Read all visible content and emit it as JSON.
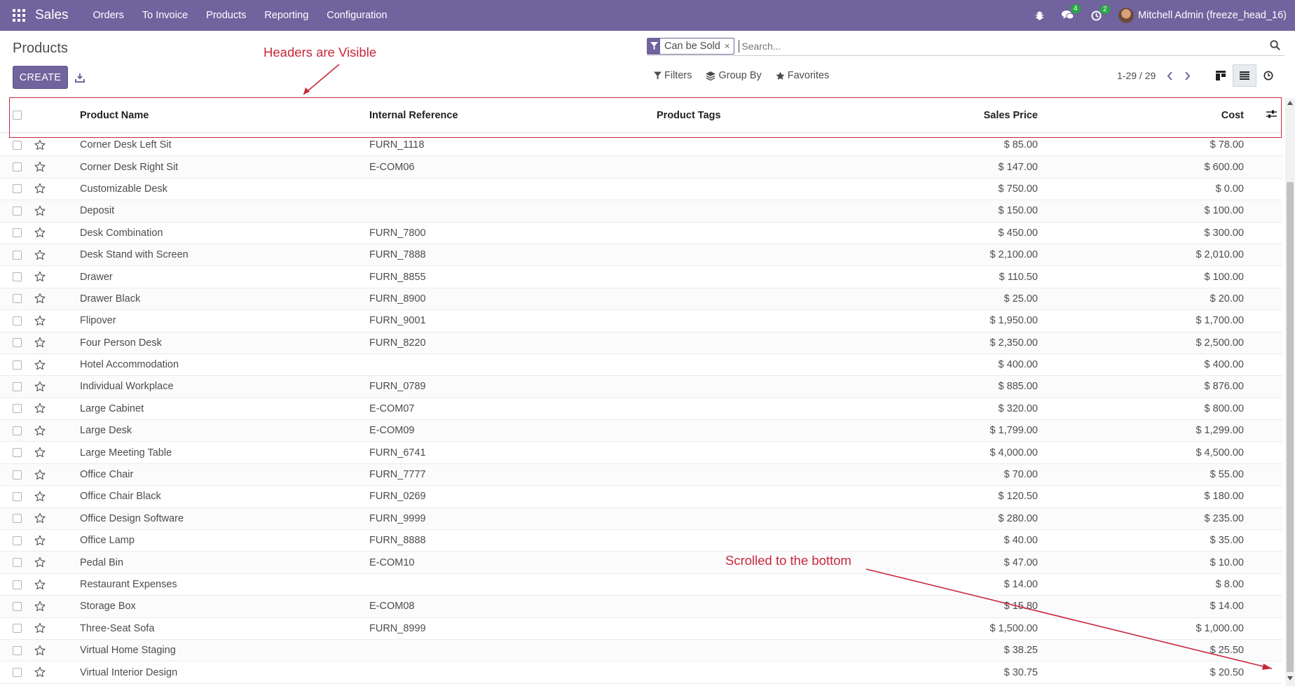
{
  "navbar": {
    "app_name": "Sales",
    "menu": [
      "Orders",
      "To Invoice",
      "Products",
      "Reporting",
      "Configuration"
    ],
    "messages_count": "4",
    "activities_count": "2",
    "user": "Mitchell Admin (freeze_head_16)"
  },
  "control_panel": {
    "title": "Products",
    "create_label": "CREATE",
    "facet": "Can be Sold",
    "facet_remove": "×",
    "search_placeholder": "Search...",
    "filters_label": "Filters",
    "groupby_label": "Group By",
    "favorites_label": "Favorites",
    "pager": "1-29 / 29"
  },
  "list": {
    "headers": {
      "name": "Product Name",
      "ref": "Internal Reference",
      "tags": "Product Tags",
      "price": "Sales Price",
      "cost": "Cost"
    },
    "rows": [
      {
        "name": "Corner Desk Left Sit",
        "ref": "FURN_1118",
        "tags": "",
        "price": "$ 85.00",
        "cost": "$ 78.00"
      },
      {
        "name": "Corner Desk Right Sit",
        "ref": "E-COM06",
        "tags": "",
        "price": "$ 147.00",
        "cost": "$ 600.00"
      },
      {
        "name": "Customizable Desk",
        "ref": "",
        "tags": "",
        "price": "$ 750.00",
        "cost": "$ 0.00"
      },
      {
        "name": "Deposit",
        "ref": "",
        "tags": "",
        "price": "$ 150.00",
        "cost": "$ 100.00"
      },
      {
        "name": "Desk Combination",
        "ref": "FURN_7800",
        "tags": "",
        "price": "$ 450.00",
        "cost": "$ 300.00"
      },
      {
        "name": "Desk Stand with Screen",
        "ref": "FURN_7888",
        "tags": "",
        "price": "$ 2,100.00",
        "cost": "$ 2,010.00"
      },
      {
        "name": "Drawer",
        "ref": "FURN_8855",
        "tags": "",
        "price": "$ 110.50",
        "cost": "$ 100.00"
      },
      {
        "name": "Drawer Black",
        "ref": "FURN_8900",
        "tags": "",
        "price": "$ 25.00",
        "cost": "$ 20.00"
      },
      {
        "name": "Flipover",
        "ref": "FURN_9001",
        "tags": "",
        "price": "$ 1,950.00",
        "cost": "$ 1,700.00"
      },
      {
        "name": "Four Person Desk",
        "ref": "FURN_8220",
        "tags": "",
        "price": "$ 2,350.00",
        "cost": "$ 2,500.00"
      },
      {
        "name": "Hotel Accommodation",
        "ref": "",
        "tags": "",
        "price": "$ 400.00",
        "cost": "$ 400.00"
      },
      {
        "name": "Individual Workplace",
        "ref": "FURN_0789",
        "tags": "",
        "price": "$ 885.00",
        "cost": "$ 876.00"
      },
      {
        "name": "Large Cabinet",
        "ref": "E-COM07",
        "tags": "",
        "price": "$ 320.00",
        "cost": "$ 800.00"
      },
      {
        "name": "Large Desk",
        "ref": "E-COM09",
        "tags": "",
        "price": "$ 1,799.00",
        "cost": "$ 1,299.00"
      },
      {
        "name": "Large Meeting Table",
        "ref": "FURN_6741",
        "tags": "",
        "price": "$ 4,000.00",
        "cost": "$ 4,500.00"
      },
      {
        "name": "Office Chair",
        "ref": "FURN_7777",
        "tags": "",
        "price": "$ 70.00",
        "cost": "$ 55.00"
      },
      {
        "name": "Office Chair Black",
        "ref": "FURN_0269",
        "tags": "",
        "price": "$ 120.50",
        "cost": "$ 180.00"
      },
      {
        "name": "Office Design Software",
        "ref": "FURN_9999",
        "tags": "",
        "price": "$ 280.00",
        "cost": "$ 235.00"
      },
      {
        "name": "Office Lamp",
        "ref": "FURN_8888",
        "tags": "",
        "price": "$ 40.00",
        "cost": "$ 35.00"
      },
      {
        "name": "Pedal Bin",
        "ref": "E-COM10",
        "tags": "",
        "price": "$ 47.00",
        "cost": "$ 10.00"
      },
      {
        "name": "Restaurant Expenses",
        "ref": "",
        "tags": "",
        "price": "$ 14.00",
        "cost": "$ 8.00"
      },
      {
        "name": "Storage Box",
        "ref": "E-COM08",
        "tags": "",
        "price": "$ 15.80",
        "cost": "$ 14.00"
      },
      {
        "name": "Three-Seat Sofa",
        "ref": "FURN_8999",
        "tags": "",
        "price": "$ 1,500.00",
        "cost": "$ 1,000.00"
      },
      {
        "name": "Virtual Home Staging",
        "ref": "",
        "tags": "",
        "price": "$ 38.25",
        "cost": "$ 25.50"
      },
      {
        "name": "Virtual Interior Design",
        "ref": "",
        "tags": "",
        "price": "$ 30.75",
        "cost": "$ 20.50"
      }
    ]
  },
  "annotations": {
    "headers_note": "Headers are Visible",
    "scroll_note": "Scrolled to the bottom"
  },
  "colors": {
    "brand": "#71639e",
    "annotation": "#c8283c",
    "badge": "#28a745"
  }
}
